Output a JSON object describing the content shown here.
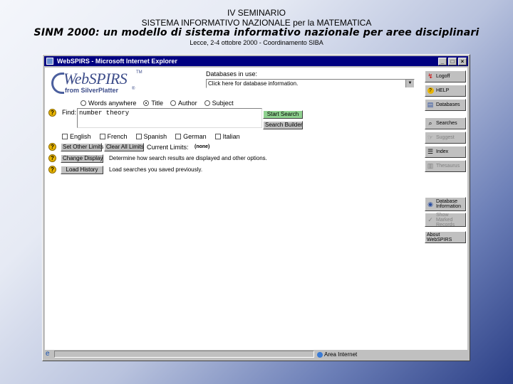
{
  "slide": {
    "line1": "IV SEMINARIO",
    "line2": "SISTEMA INFORMATIVO NAZIONALE per la MATEMATICA",
    "line3": "SINM 2000: un modello di sistema informativo nazionale per aree disciplinari",
    "line4": "Lecce, 2-4 ottobre 2000 - Coordinamento SIBA"
  },
  "window": {
    "title": "WebSPIRS - Microsoft Internet Explorer",
    "status_zone": "Area Internet"
  },
  "logo": {
    "main": "WebSPIRS",
    "sub": "from SilverPlatter",
    "tm": "TM",
    "reg": "®"
  },
  "databases": {
    "label": "Databases in use:",
    "selected": "Click here for database information."
  },
  "search": {
    "options": [
      {
        "label": "Words anywhere",
        "selected": false
      },
      {
        "label": "Title",
        "selected": true
      },
      {
        "label": "Author",
        "selected": false
      },
      {
        "label": "Subject",
        "selected": false
      }
    ],
    "find_label": "Find:",
    "query": "number theory",
    "start_label": "Start Search",
    "builder_label": "Search Builder"
  },
  "languages": [
    "English",
    "French",
    "Spanish",
    "German",
    "Italian"
  ],
  "limits": {
    "set_label": "Set Other Limits",
    "clear_label": "Clear All Limits",
    "current_label": "Current Limits:",
    "current_value": "(none)"
  },
  "display": {
    "button": "Change Display",
    "text": "Determine how search results are displayed and other options."
  },
  "history": {
    "button": "Load History",
    "text": "Load searches you saved previously."
  },
  "sidebar": [
    {
      "label": "Logoff",
      "icon": "logoff-icon",
      "enabled": true
    },
    {
      "label": "HELP",
      "icon": "help-icon",
      "enabled": true
    },
    {
      "label": "Databases",
      "icon": "databases-icon",
      "enabled": true
    },
    {
      "label": "Searches",
      "icon": "searches-icon",
      "enabled": true
    },
    {
      "label": "Suggest",
      "icon": "suggest-icon",
      "enabled": false
    },
    {
      "label": "Index",
      "icon": "index-icon",
      "enabled": true
    },
    {
      "label": "Thesaurus",
      "icon": "thesaurus-icon",
      "enabled": false
    },
    {
      "label": "Database\nInformation",
      "icon": "database-information-icon",
      "enabled": true
    },
    {
      "label": "Show Marked\nRecords",
      "icon": "marked-records-icon",
      "enabled": false
    },
    {
      "label": "About WebSPIRS",
      "icon": "about-icon",
      "enabled": true
    }
  ]
}
